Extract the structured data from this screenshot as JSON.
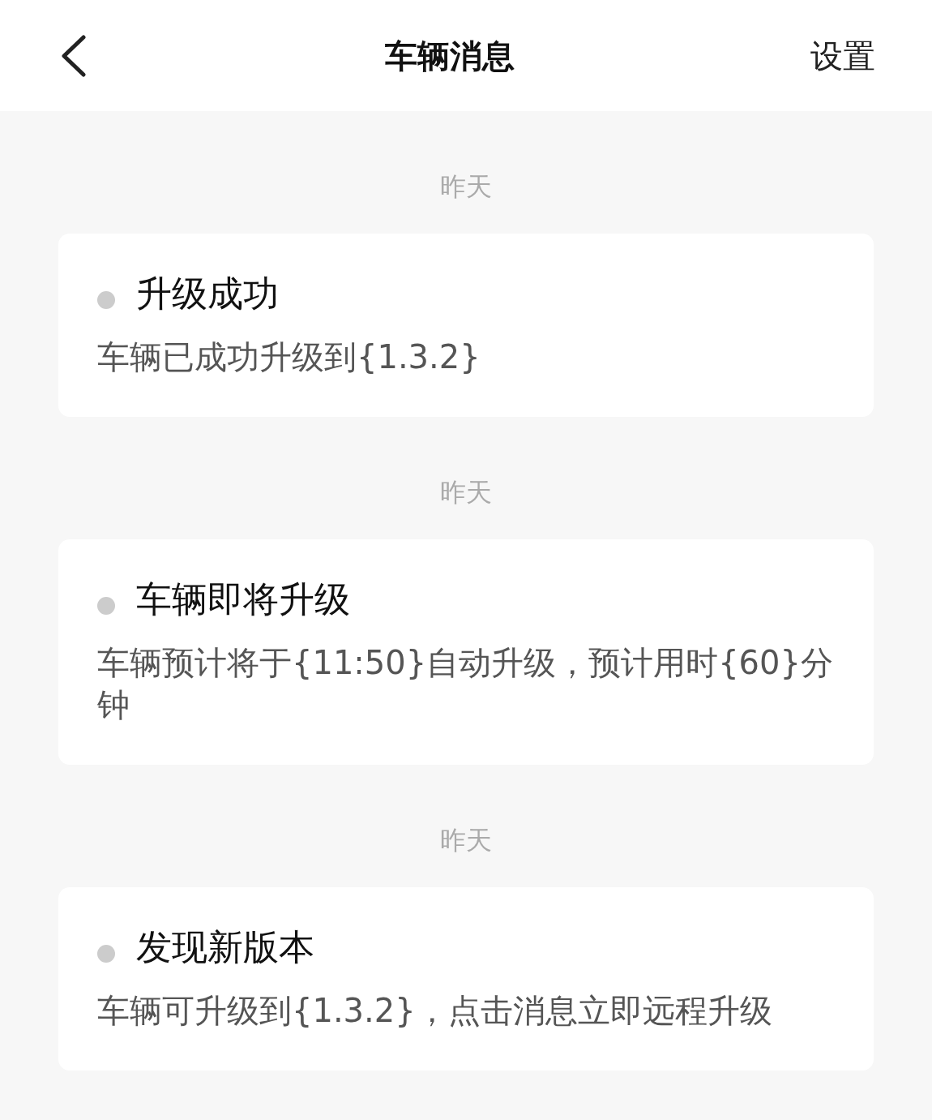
{
  "header": {
    "title": "车辆消息",
    "settings": "设置"
  },
  "messages": [
    {
      "date": "昨天",
      "title": "升级成功",
      "body": "车辆已成功升级到{1.3.2}"
    },
    {
      "date": "昨天",
      "title": "车辆即将升级",
      "body": "车辆预计将于{11:50}自动升级，预计用时{60}分钟"
    },
    {
      "date": "昨天",
      "title": "发现新版本",
      "body": "车辆可升级到{1.3.2}，点击消息立即远程升级"
    }
  ]
}
